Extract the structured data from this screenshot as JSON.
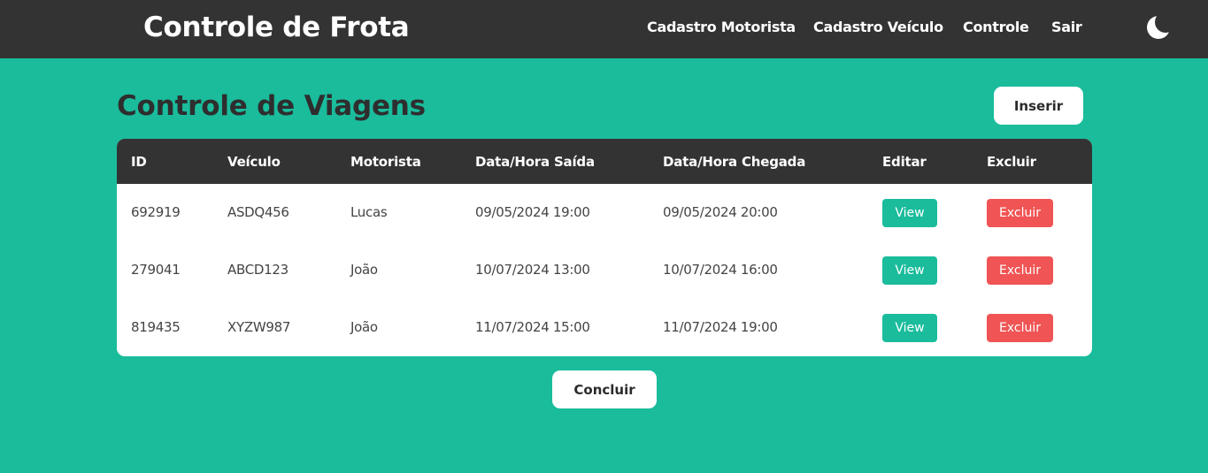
{
  "header": {
    "title": "Controle de Frota",
    "nav": [
      {
        "label": "Cadastro Motorista"
      },
      {
        "label": "Cadastro Veículo"
      },
      {
        "label": "Controle"
      },
      {
        "label": "Sair"
      }
    ],
    "theme_icon": "moon-icon"
  },
  "main": {
    "title": "Controle de Viagens",
    "insert_label": "Inserir",
    "conclude_label": "Concluir"
  },
  "table": {
    "columns": [
      "ID",
      "Veículo",
      "Motorista",
      "Data/Hora Saída",
      "Data/Hora Chegada",
      "Editar",
      "Excluir"
    ],
    "rows": [
      {
        "id": "692919",
        "veiculo": "ASDQ456",
        "motorista": "Lucas",
        "saida": "09/05/2024 19:00",
        "chegada": "09/05/2024 20:00",
        "view_label": "View",
        "delete_label": "Excluir"
      },
      {
        "id": "279041",
        "veiculo": "ABCD123",
        "motorista": "João",
        "saida": "10/07/2024 13:00",
        "chegada": "10/07/2024 16:00",
        "view_label": "View",
        "delete_label": "Excluir"
      },
      {
        "id": "819435",
        "veiculo": "XYZW987",
        "motorista": "João",
        "saida": "11/07/2024 15:00",
        "chegada": "11/07/2024 19:00",
        "view_label": "View",
        "delete_label": "Excluir"
      }
    ]
  },
  "colors": {
    "background": "#1abc9c",
    "header": "#333333",
    "view_button": "#1abc9c",
    "delete_button": "#f05454"
  }
}
